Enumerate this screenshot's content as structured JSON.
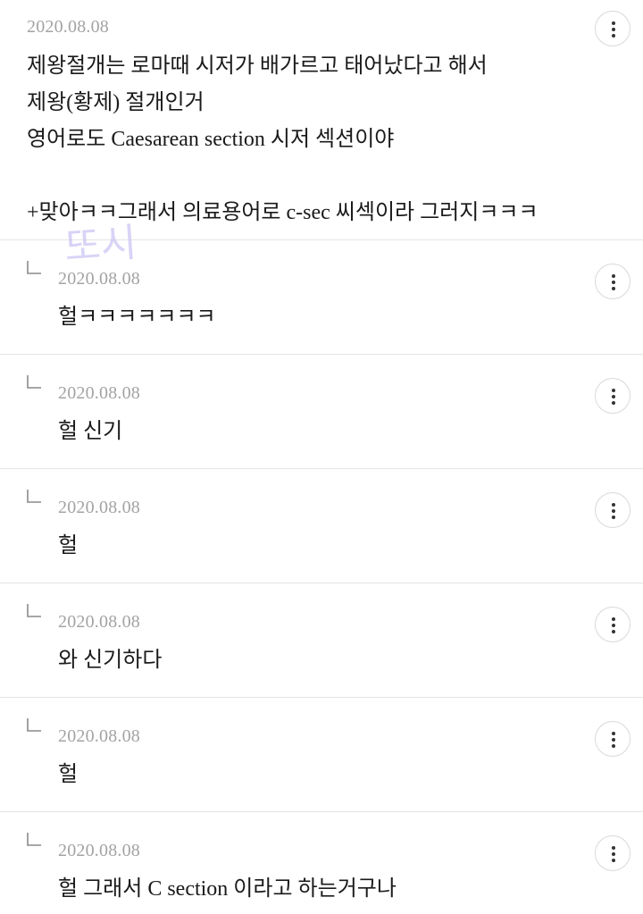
{
  "comments": [
    {
      "date": "2020.08.08",
      "text": "제왕절개는 로마때 시저가 배가르고 태어났다고 해서\n제왕(황제) 절개인거\n영어로도 Caesarean section 시저 섹션이야\n\n+맞아ㅋㅋ그래서 의료용어로 c-sec 씨섹이라 그러지ㅋㅋㅋ",
      "is_reply": false,
      "more_icon": "more-vertical-icon"
    },
    {
      "date": "2020.08.08",
      "text": "헐ㅋㅋㅋㅋㅋㅋㅋ",
      "is_reply": true,
      "more_icon": "more-vertical-icon"
    },
    {
      "date": "2020.08.08",
      "text": "헐 신기",
      "is_reply": true,
      "more_icon": "more-vertical-icon"
    },
    {
      "date": "2020.08.08",
      "text": "헐",
      "is_reply": true,
      "more_icon": "more-vertical-icon"
    },
    {
      "date": "2020.08.08",
      "text": "와 신기하다",
      "is_reply": true,
      "more_icon": "more-vertical-icon"
    },
    {
      "date": "2020.08.08",
      "text": "헐",
      "is_reply": true,
      "more_icon": "more-vertical-icon"
    },
    {
      "date": "2020.08.08",
      "text": "헐 그래서 C section 이라고 하는거구나",
      "is_reply": true,
      "more_icon": "more-vertical-icon"
    }
  ],
  "watermark": {
    "text": "또시",
    "color": "#ccc6f4"
  },
  "colors": {
    "date": "#a3a3a3",
    "text": "#1a1a1a",
    "divider": "#e4e4e4",
    "reply_icon": "#8a8a8a"
  }
}
